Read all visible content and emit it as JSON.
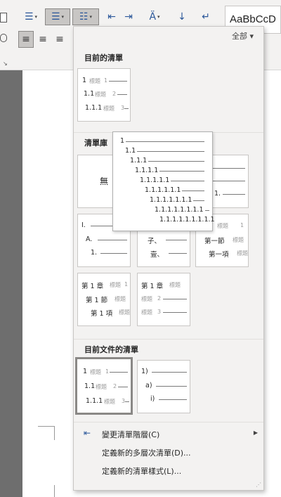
{
  "ribbon": {
    "style_preview": "AaBbCcD",
    "bullets_icon": "bullets-icon",
    "numbering_icon": "numbering-icon",
    "multilevel_icon": "multilevel-list-icon",
    "decrease_indent_icon": "decrease-indent-icon",
    "increase_indent_icon": "increase-indent-icon",
    "sort_icon": "sort-icon",
    "show_marks_icon": "paragraph-marks-icon"
  },
  "gallery": {
    "filter_label": "全部 ▾",
    "current_list_heading": "目前的清單",
    "list_library_heading": "清單庫",
    "document_lists_heading": "目前文件的清單",
    "none_label": "無",
    "heading_word": "標題",
    "current_list": {
      "levels": [
        {
          "num": "1",
          "tag": "1"
        },
        {
          "num": "1.1",
          "tag": "2"
        },
        {
          "num": "1.1.1",
          "tag": "3"
        }
      ]
    },
    "library": {
      "thumb_numbered": {
        "l1": "1",
        "l2": "1.1",
        "l3": "1."
      },
      "thumb_roman": {
        "l1": "I.",
        "l2": "A.",
        "l3": "1."
      },
      "thumb_chinese": {
        "l1": "子、",
        "l2": "壹、"
      },
      "thumb_chapter_cn": {
        "l1": "一章",
        "l2": "第一節",
        "l3": "第一項",
        "tag1": "1",
        "tag2": "",
        "tag3": ""
      },
      "thumb_chapter_a": {
        "l1": "第 1 章",
        "l2": "第 1 節",
        "l3": "第 1 項",
        "tag1": "1",
        "tag2": "",
        "tag3": ""
      },
      "thumb_chapter_b": {
        "l1": "第 1 章",
        "tag2": "2",
        "tag3": "3"
      }
    },
    "document_lists": {
      "thumb_a": {
        "l1": "1",
        "l2": "1.1",
        "l3": "1.1.1",
        "tag1": "1",
        "tag2": "2",
        "tag3": "3"
      },
      "thumb_b": {
        "l1": "1)",
        "l2": "a)",
        "l3": "i)"
      }
    },
    "preview_levels": [
      "1",
      "1.1",
      "1.1.1",
      "1.1.1.1",
      "1.1.1.1.1",
      "1.1.1.1.1.1",
      "1.1.1.1.1.1.1",
      "1.1.1.1.1.1.1.1",
      "1.1.1.1.1.1.1.1.1"
    ],
    "menu": {
      "change_level": "變更清單階層(C)",
      "define_multilevel": "定義新的多層次清單(D)...",
      "define_style": "定義新的清單樣式(L)..."
    }
  }
}
